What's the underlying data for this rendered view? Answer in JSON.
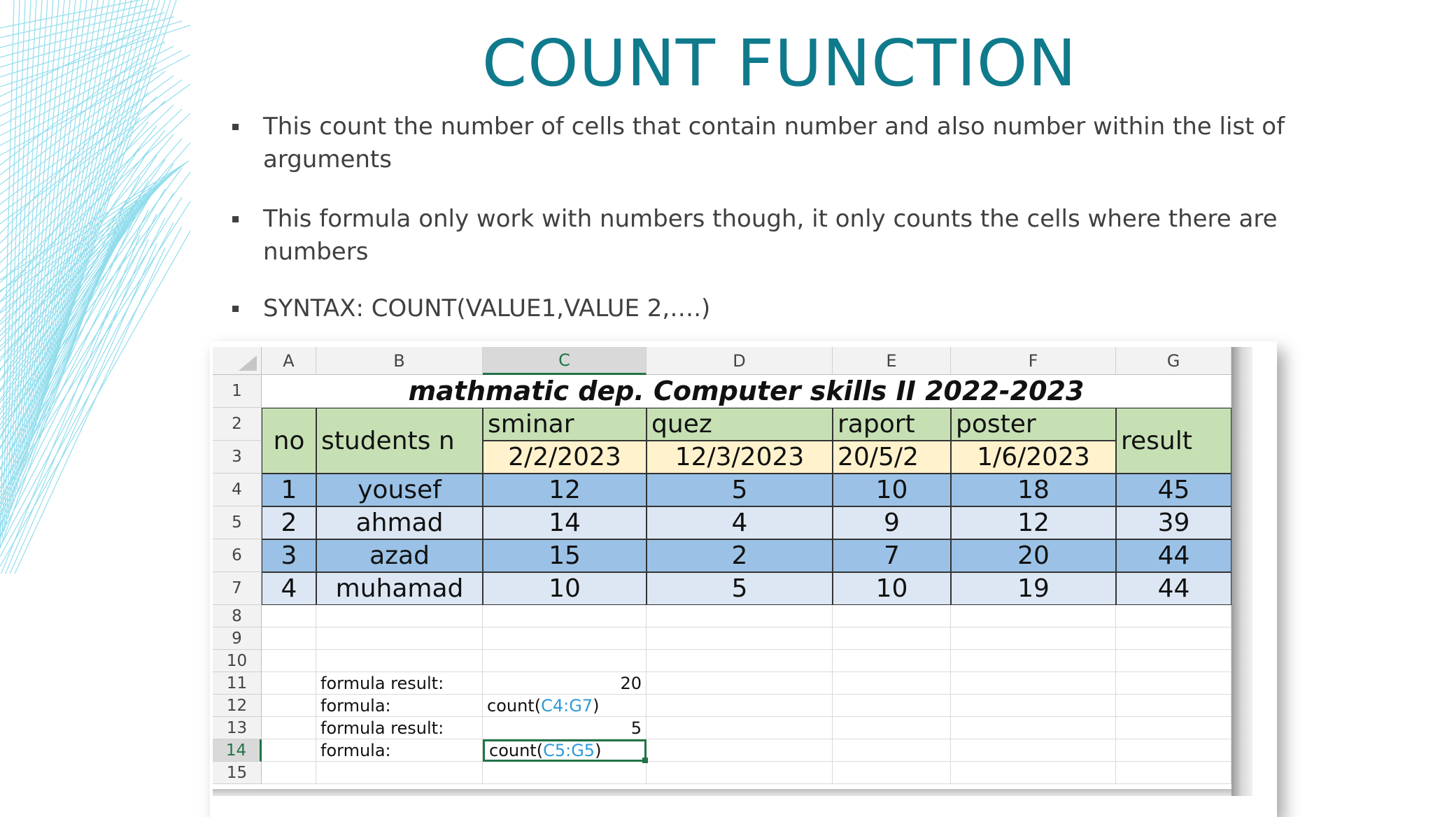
{
  "slide": {
    "title": "COUNT FUNCTION",
    "bullets": [
      "This count the number of cells that contain number and also number within the list of arguments",
      "This formula only work with numbers though, it only counts the cells where there are numbers",
      "SYNTAX: COUNT(VALUE1,VALUE 2,….)"
    ],
    "accent_color": "#0f7a8c",
    "decoration": "cyan-wireframe-lines"
  },
  "sheet": {
    "columns": [
      "A",
      "B",
      "C",
      "D",
      "E",
      "F",
      "G"
    ],
    "selected_column": "C",
    "rows": [
      "1",
      "2",
      "3",
      "4",
      "5",
      "6",
      "7",
      "8",
      "9",
      "10",
      "11",
      "12",
      "13",
      "14",
      "15"
    ],
    "selected_row": "14",
    "title": "mathmatic dep. Computer skills II 2022-2023",
    "headers": {
      "no": "no",
      "students": "students n",
      "sminar": "sminar",
      "quez": "quez",
      "raport": "raport",
      "poster": "poster",
      "result": "result",
      "sminar_date": "2/2/2023",
      "quez_date": "12/3/2023",
      "raport_date": "20/5/2",
      "poster_date": "1/6/2023"
    },
    "data": [
      {
        "no": "1",
        "name": "yousef",
        "sminar": "12",
        "quez": "5",
        "raport": "10",
        "poster": "18",
        "result": "45"
      },
      {
        "no": "2",
        "name": "ahmad",
        "sminar": "14",
        "quez": "4",
        "raport": "9",
        "poster": "12",
        "result": "39"
      },
      {
        "no": "3",
        "name": "azad",
        "sminar": "15",
        "quez": "2",
        "raport": "7",
        "poster": "20",
        "result": "44"
      },
      {
        "no": "4",
        "name": "muhamad",
        "sminar": "10",
        "quez": "5",
        "raport": "10",
        "poster": "19",
        "result": "44"
      }
    ],
    "formula1": {
      "result_label": "formula result:",
      "result_value": "20",
      "formula_label": "formula:",
      "formula_prefix": "count(",
      "formula_ref": "C4:G7",
      "formula_suffix": ")"
    },
    "formula2": {
      "result_label": "formula result:",
      "result_value": "5",
      "formula_label": "formula:",
      "formula_prefix": "count(",
      "formula_ref": "C5:G5",
      "formula_suffix": ")"
    },
    "colors": {
      "header_green": "#c6e0b4",
      "header_yellow": "#fff2cc",
      "row_dark_blue": "#9bc2e6",
      "row_light_blue": "#dde7f4",
      "reference_blue": "#2e9bd6",
      "selection_green": "#217346"
    }
  }
}
